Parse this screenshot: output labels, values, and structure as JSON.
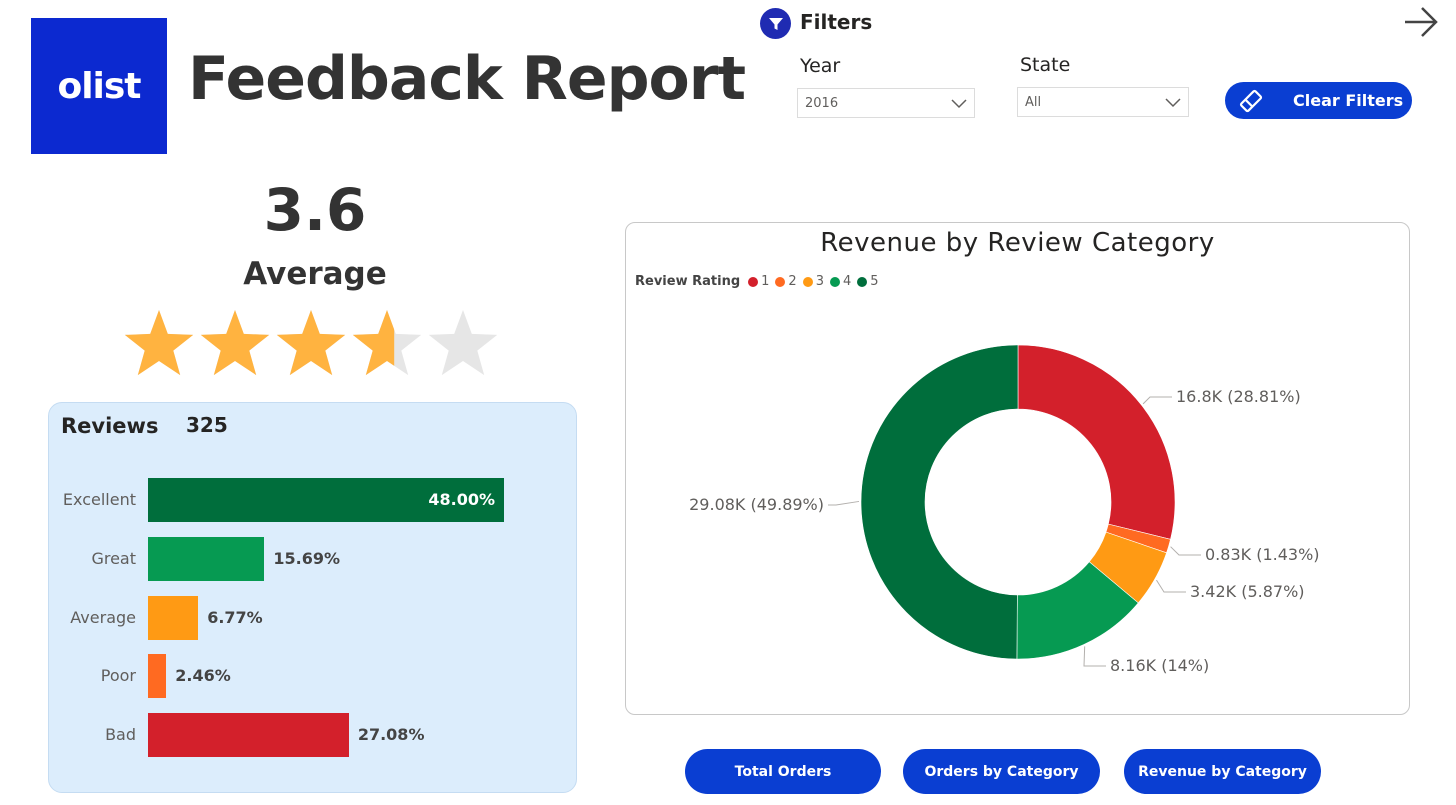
{
  "header": {
    "logo_text": "olist",
    "title": "Feedback Report",
    "brand_color": "#0c29d0"
  },
  "filters": {
    "title": "Filters",
    "year_label": "Year",
    "year_value": "2016",
    "state_label": "State",
    "state_value": "All",
    "clear_label": "Clear Filters",
    "icons": [
      "funnel-icon",
      "chevron-down-icon",
      "eraser-icon",
      "arrow-right-icon"
    ]
  },
  "rating": {
    "value": "3.6",
    "label": "Average",
    "stars_out_of": 5,
    "stars_filled": 3.6,
    "star_color": "#ffb340",
    "star_empty_color": "#e6e6e6"
  },
  "reviews": {
    "title": "Reviews",
    "count": "325",
    "bars": [
      {
        "label": "Excellent",
        "percent": 48.0,
        "value_label": "48.00%",
        "color": "#006e3c"
      },
      {
        "label": "Great",
        "percent": 15.69,
        "value_label": "15.69%",
        "color": "#069a52"
      },
      {
        "label": "Average",
        "percent": 6.77,
        "value_label": "6.77%",
        "color": "#ff9a14"
      },
      {
        "label": "Poor",
        "percent": 2.46,
        "value_label": "2.46%",
        "color": "#ff6a21"
      },
      {
        "label": "Bad",
        "percent": 27.08,
        "value_label": "27.08%",
        "color": "#d3202b"
      }
    ]
  },
  "chart_data": {
    "type": "pie",
    "title": "Revenue by Review Category",
    "legend_title": "Review Rating",
    "legend_position": "top-left",
    "donut": true,
    "categories": [
      "1",
      "2",
      "3",
      "4",
      "5"
    ],
    "values": [
      16.8,
      0.83,
      3.42,
      8.16,
      29.08
    ],
    "percents": [
      28.81,
      1.43,
      5.87,
      14,
      49.89
    ],
    "data_labels": [
      "16.8K (28.81%)",
      "0.83K (1.43%)",
      "3.42K (5.87%)",
      "8.16K (14%)",
      "29.08K (49.89%)"
    ],
    "colors": [
      "#d3202b",
      "#ff6a21",
      "#ff9a14",
      "#069a52",
      "#006e3c"
    ]
  },
  "nav": {
    "buttons": [
      "Total Orders",
      "Orders by Category",
      "Revenue by Category"
    ]
  }
}
